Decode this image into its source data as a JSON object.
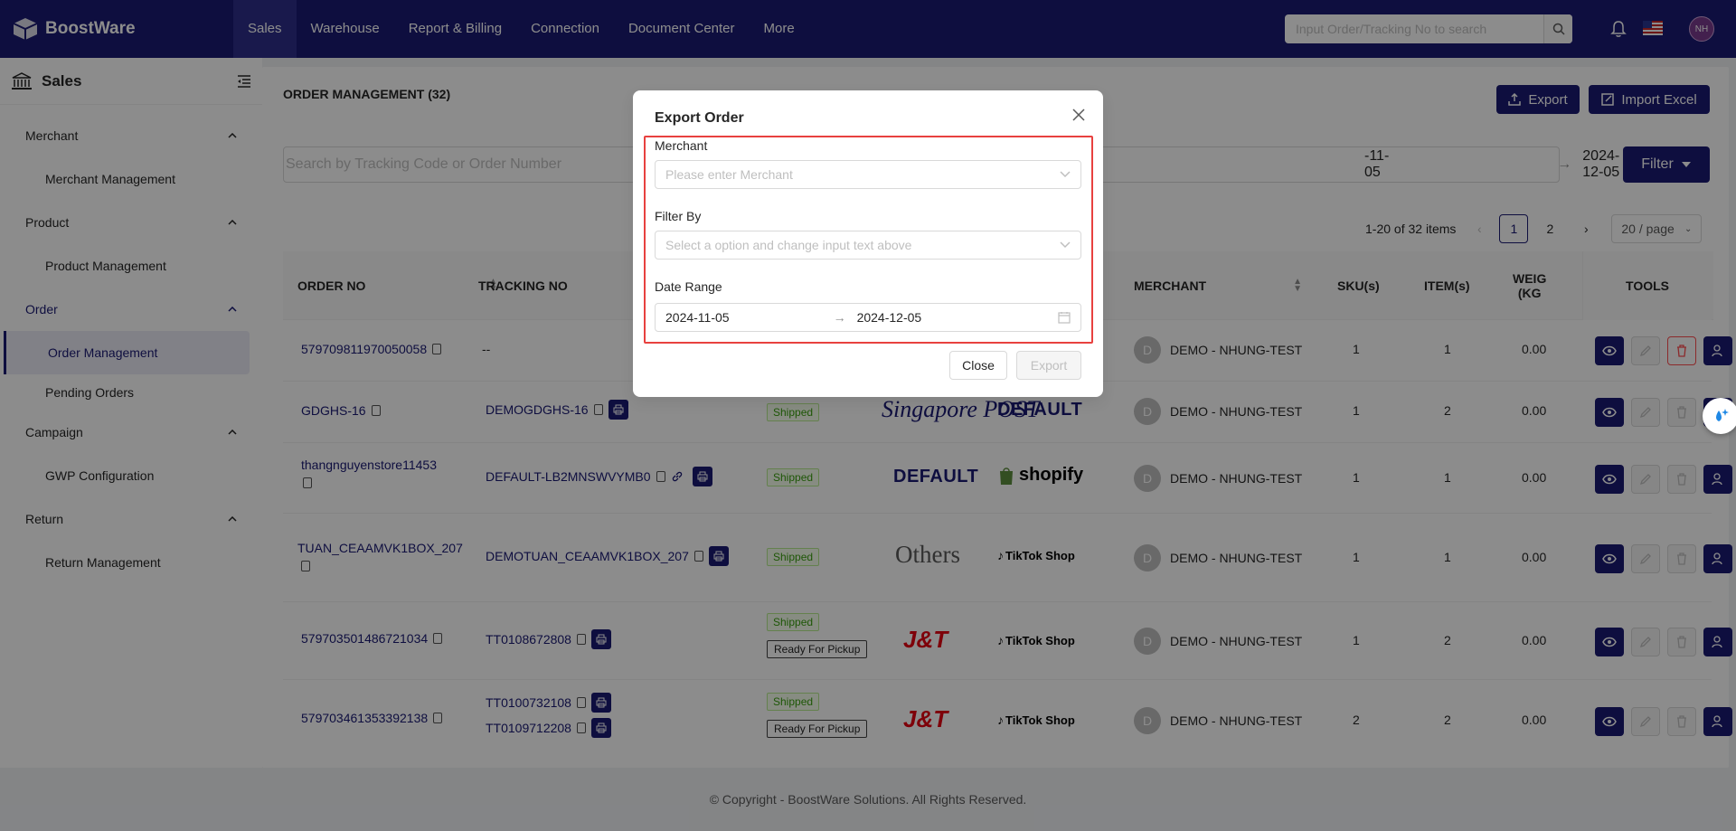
{
  "app": {
    "name": "BoostWare"
  },
  "nav": {
    "items": [
      "Sales",
      "Warehouse",
      "Report & Billing",
      "Connection",
      "Document Center",
      "More"
    ],
    "search_placeholder": "Input Order/Tracking No to search",
    "avatar": "NH"
  },
  "sidebar": {
    "title": "Sales",
    "groups": [
      {
        "label": "Merchant",
        "sub": "Merchant Management"
      },
      {
        "label": "Product",
        "sub": "Product Management"
      },
      {
        "label": "Order",
        "sub": "Order Management",
        "sub2": "Pending Orders"
      },
      {
        "label": "Campaign",
        "sub": "GWP Configuration"
      },
      {
        "label": "Return",
        "sub": "Return Management"
      }
    ]
  },
  "main": {
    "title": "ORDER MANAGEMENT (32)",
    "export_label": "Export",
    "import_label": "Import Excel",
    "search_placeholder": "Search by Tracking Code or Order Number",
    "date_from": "-11-05",
    "date_to": "2024-12-05",
    "filter_label": "Filter",
    "pagination": {
      "range": "1-20 of 32 items",
      "page1": "1",
      "page2": "2",
      "size": "20 / page"
    },
    "columns": {
      "order_no": "ORDER NO",
      "tracking_no": "TRACKING NO",
      "merchant": "MERCHANT",
      "skus": "SKU(s)",
      "items": "ITEM(s)",
      "weight": "WEIG",
      "weight2": "(KG",
      "tools": "TOOLS"
    },
    "rows": [
      {
        "order": "579709811970050058",
        "tracking": "--",
        "merchant": "DEMO - NHUNG-TEST",
        "sku": "1",
        "item": "1",
        "weight": "0.00"
      },
      {
        "order": "GDGHS-16",
        "tracking": "DEMOGDGHS-16",
        "status": "Shipped",
        "carrier": "Singapore POST",
        "channel": "DEFAULT",
        "merchant": "DEMO - NHUNG-TEST",
        "sku": "1",
        "item": "2",
        "weight": "0.00"
      },
      {
        "order": "thangnguyenstore11453",
        "tracking": "DEFAULT-LB2MNSWVYMB0",
        "status": "Shipped",
        "carrier": "DEFAULT",
        "channel": "shopify",
        "merchant": "DEMO - NHUNG-TEST",
        "sku": "1",
        "item": "1",
        "weight": "0.00"
      },
      {
        "order": "TUAN_CEAAMVK1BOX_207",
        "tracking": "DEMOTUAN_CEAAMVK1BOX_207",
        "status": "Shipped",
        "carrier": "Others",
        "channel": "TikTok Shop",
        "merchant": "DEMO - NHUNG-TEST",
        "sku": "1",
        "item": "1",
        "weight": "0.00"
      },
      {
        "order": "579703501486721034",
        "tracking": "TT0108672808",
        "status": "Shipped",
        "status2": "Ready For Pickup",
        "carrier": "J&T",
        "channel": "TikTok Shop",
        "merchant": "DEMO - NHUNG-TEST",
        "sku": "1",
        "item": "2",
        "weight": "0.00"
      },
      {
        "order": "579703461353392138",
        "tracking": "TT0100732108",
        "tracking2": "TT0109712208",
        "status": "Shipped",
        "status2": "Ready For Pickup",
        "carrier": "J&T",
        "channel": "TikTok Shop",
        "merchant": "DEMO - NHUNG-TEST",
        "sku": "2",
        "item": "2",
        "weight": "0.00"
      }
    ],
    "merchant_initial": "D"
  },
  "footer": "© Copyright - BoostWare Solutions. All Rights Reserved.",
  "modal": {
    "title": "Export Order",
    "merchant_label": "Merchant",
    "merchant_placeholder": "Please enter Merchant",
    "filter_label": "Filter By",
    "filter_placeholder": "Select a option and change input text above",
    "date_label": "Date Range",
    "date_from": "2024-11-05",
    "date_to": "2024-12-05",
    "close_label": "Close",
    "export_label": "Export"
  },
  "colors": {
    "primary": "#1b1a74",
    "highlight": "#e8413f",
    "shipped": "#389e0d"
  }
}
